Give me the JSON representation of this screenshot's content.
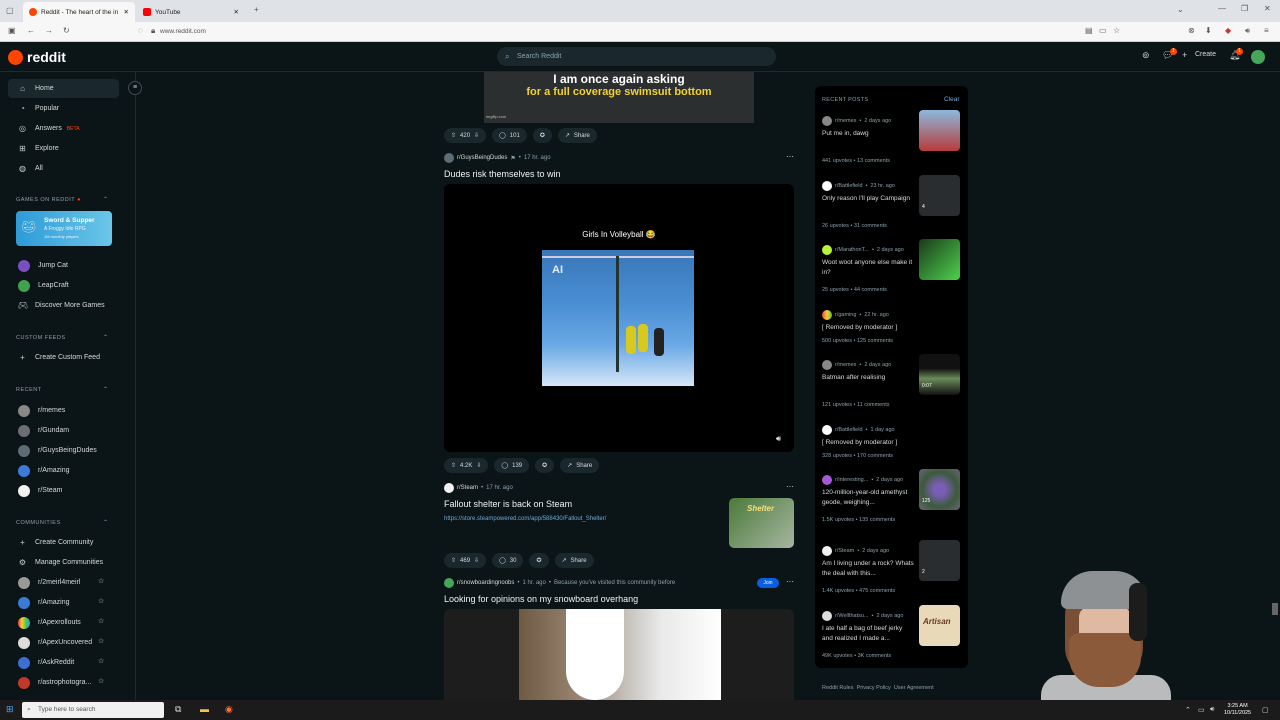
{
  "browser": {
    "tabs": [
      {
        "label": "Reddit - The heart of the in",
        "active": true
      },
      {
        "label": "YouTube",
        "active": false
      }
    ],
    "url": "www.reddit.com"
  },
  "header": {
    "logo_text": "reddit",
    "search_placeholder": "Search Reddit",
    "create_label": "Create",
    "chat_badge": "1",
    "notif_badge": "1"
  },
  "sidebar": {
    "nav": [
      {
        "label": "Home",
        "icon": "home-icon"
      },
      {
        "label": "Popular",
        "icon": "popular-icon"
      },
      {
        "label": "Answers",
        "icon": "answers-icon",
        "badge": "BETA"
      },
      {
        "label": "Explore",
        "icon": "explore-icon"
      },
      {
        "label": "All",
        "icon": "all-icon"
      }
    ],
    "games_header": "GAMES ON REDDIT",
    "game_banner": {
      "title": "Sword & Supper",
      "subtitle": "A Froggy Idle RPG",
      "players": "1M monthly players"
    },
    "games": [
      {
        "label": "Jump Cat"
      },
      {
        "label": "LeapCraft"
      },
      {
        "label": "Discover More Games"
      }
    ],
    "custom_header": "CUSTOM FEEDS",
    "custom_create": "Create Custom Feed",
    "recent_header": "RECENT",
    "recent": [
      "r/memes",
      "r/Gundam",
      "r/GuysBeingDudes",
      "r/Amazing",
      "r/Steam"
    ],
    "communities_header": "COMMUNITIES",
    "create_community": "Create Community",
    "manage_communities": "Manage Communities",
    "communities": [
      "r/2meirl4meirl",
      "r/Amazing",
      "r/Apexrollouts",
      "r/ApexUncovered",
      "r/AskReddit",
      "r/astrophotogra..."
    ]
  },
  "feed": {
    "post0": {
      "meme_line1": "I am once again asking",
      "meme_line2": "for a full coverage swimsuit bottom",
      "watermark": "imgflip.com",
      "votes": "420",
      "comments": "101",
      "share": "Share"
    },
    "post1": {
      "subreddit": "r/GuysBeingDudes",
      "time": "17 hr. ago",
      "title": "Dudes risk themselves to win",
      "video_caption": "Girls In Volleyball 😂",
      "overlay": "AI",
      "votes": "4.2K",
      "comments": "139",
      "share": "Share"
    },
    "post2": {
      "subreddit": "r/Steam",
      "time": "17 hr. ago",
      "title": "Fallout shelter is back on Steam",
      "link": "https://store.steampowered.com/app/588430/Fallout_Shelter/",
      "thumb_text": "Shelter",
      "votes": "469",
      "comments": "30",
      "share": "Share"
    },
    "post3": {
      "subreddit": "r/snowboardingnoobs",
      "time": "1 hr. ago",
      "reason": "Because you've visited this community before",
      "join": "Join",
      "title": "Looking for opinions on my snowboard overhang"
    }
  },
  "recent_posts": {
    "header": "RECENT POSTS",
    "clear": "Clear",
    "items": [
      {
        "sub": "r/memes",
        "age": "2 days ago",
        "title": "Put me in, dawg",
        "upvotes": "441 upvotes",
        "comments": "13 comments"
      },
      {
        "sub": "r/Battlefield",
        "age": "23 hr. ago",
        "title": "Only reason I'll play Campaign",
        "upvotes": "26 upvotes",
        "comments": "31 comments",
        "thumb_badge": "4"
      },
      {
        "sub": "r/MarathonT...",
        "age": "2 days ago",
        "title": "Woot woot anyone else make it in?",
        "upvotes": "25 upvotes",
        "comments": "44 comments"
      },
      {
        "sub": "r/gaming",
        "age": "22 hr. ago",
        "title": "[ Removed by moderator ]",
        "upvotes": "500 upvotes",
        "comments": "125 comments"
      },
      {
        "sub": "r/memes",
        "age": "2 days ago",
        "title": "Batman after realising",
        "upvotes": "121 upvotes",
        "comments": "11 comments",
        "thumb_badge": "0:07"
      },
      {
        "sub": "r/Battlefield",
        "age": "1 day ago",
        "title": "[ Removed by moderator ]",
        "upvotes": "328 upvotes",
        "comments": "170 comments"
      },
      {
        "sub": "r/interesting...",
        "age": "2 days ago",
        "title": "120-million-year-old amethyst geode, weighing...",
        "upvotes": "1.5K upvotes",
        "comments": "135 comments",
        "thumb_badge": "125"
      },
      {
        "sub": "r/Steam",
        "age": "2 days ago",
        "title": "Am I living under a rock? Whats the deal with this...",
        "upvotes": "1.4K upvotes",
        "comments": "475 comments",
        "thumb_badge": "2"
      },
      {
        "sub": "r/Wellthatsu...",
        "age": "2 days ago",
        "title": "I ate half a bag of beef jerky and realized I made a...",
        "upvotes": "49K upvotes",
        "comments": "3K comments",
        "thumb_text": "Artisan"
      }
    ],
    "footer": [
      "Reddit Rules",
      "Privacy Policy",
      "User Agreement"
    ]
  },
  "taskbar": {
    "search_placeholder": "Type here to search",
    "time": "3:25 AM",
    "date": "10/11/2025"
  }
}
